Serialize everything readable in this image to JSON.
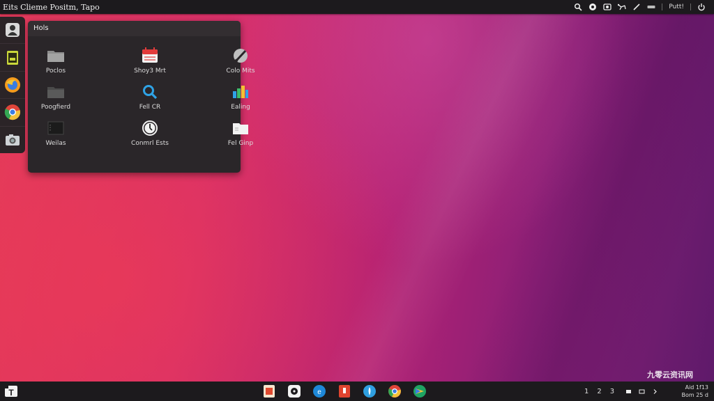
{
  "topbar": {
    "title": "Eits Clieme Positm, Tapo",
    "user_label": "Putt!",
    "tray_icons": [
      "search-icon",
      "chat-icon",
      "screenshot-icon",
      "network-icon",
      "pen-icon",
      "battery-icon",
      "power-icon"
    ]
  },
  "dock": {
    "items": [
      {
        "name": "user-profile-icon"
      },
      {
        "name": "notes-app-icon"
      },
      {
        "name": "firefox-icon"
      },
      {
        "name": "chrome-icon"
      },
      {
        "name": "camera-icon"
      }
    ]
  },
  "panel": {
    "title": "Hols",
    "apps": [
      {
        "label": "Poclos",
        "icon": "folder-icon"
      },
      {
        "label": "Shoy3 Mrt",
        "icon": "calendar-icon"
      },
      {
        "label": "Colo Mits",
        "icon": "paint-brush-icon"
      },
      {
        "label": "Poogfierd",
        "icon": "dark-folder-icon"
      },
      {
        "label": "Fell CR",
        "icon": "search-app-icon"
      },
      {
        "label": "Ealing",
        "icon": "chart-app-icon"
      },
      {
        "label": "Weilas",
        "icon": "terminal-icon"
      },
      {
        "label": "Conmrl Ests",
        "icon": "clock-icon"
      },
      {
        "label": "Fel Ginp",
        "icon": "file-icon"
      }
    ]
  },
  "taskbar": {
    "start_label": "T",
    "apps": [
      "text-editor-icon",
      "media-player-icon",
      "edge-icon",
      "office-icon",
      "feather-icon",
      "chrome-icon",
      "store-icon"
    ],
    "workspaces": [
      "1",
      "2",
      "3"
    ],
    "time_line1": "Aid 1f13",
    "time_line2": "Bom 25 d"
  },
  "watermark": "九零云资讯网"
}
